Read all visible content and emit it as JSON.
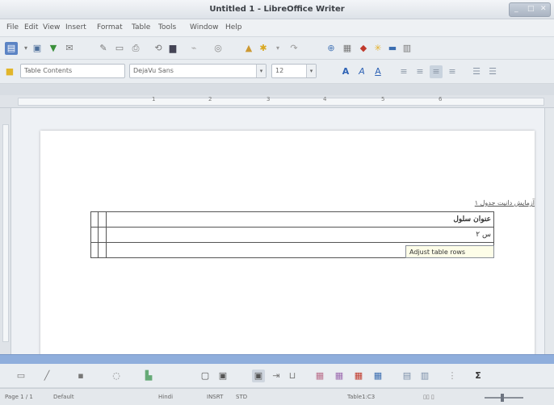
{
  "window": {
    "title": "Untitled 1 - LibreOffice Writer",
    "controls": [
      "_",
      "□",
      "✕"
    ]
  },
  "menu": [
    "File",
    "Edit",
    "View",
    "Insert",
    "Format",
    "Table",
    "Tools",
    "Window",
    "Help"
  ],
  "formatting": {
    "style": "Table Contents",
    "font": "DejaVu Sans",
    "size": "12"
  },
  "ruler_numbers": [
    "1",
    "2",
    "3",
    "4",
    "5",
    "6"
  ],
  "document": {
    "caption": "آزمایش دانیت جدول ۱",
    "table": {
      "rows": [
        [
          "",
          "",
          "عنوان سلول"
        ],
        [
          "",
          "",
          "س ۲"
        ],
        [
          "",
          "",
          ""
        ]
      ]
    },
    "tooltip": "Adjust table rows"
  },
  "status": {
    "page": "Page 1 / 1",
    "style": "Default",
    "language": "Hindi",
    "insert_mode": "INSRT",
    "selection_mode": "STD",
    "table_cell": "Table1:C3"
  },
  "icons": {
    "standard": [
      "new-icon",
      "open-icon",
      "save-icon",
      "email-icon",
      "edit-icon",
      "pdf-icon",
      "print-icon",
      "preview-icon",
      "spellcheck-icon",
      "autocheck-icon",
      "cut-icon",
      "copy-icon",
      "paste-icon",
      "clone-icon",
      "undo-icon",
      "redo-icon",
      "hyperlink-icon",
      "table-icon",
      "draw-icon",
      "find-icon",
      "navigator-icon",
      "gallery-icon"
    ],
    "drawing": [
      "select-icon",
      "line-icon",
      "rectangle-icon",
      "ellipse-icon",
      "polygon-icon",
      "shapes-icon",
      "stars-icon",
      "textbox-icon",
      "fontwork-icon",
      "extrusion-icon",
      "align-icon",
      "arrange-icon"
    ]
  },
  "colors": {
    "accent": "#8faedc",
    "titlebar": "#dde2e8"
  }
}
